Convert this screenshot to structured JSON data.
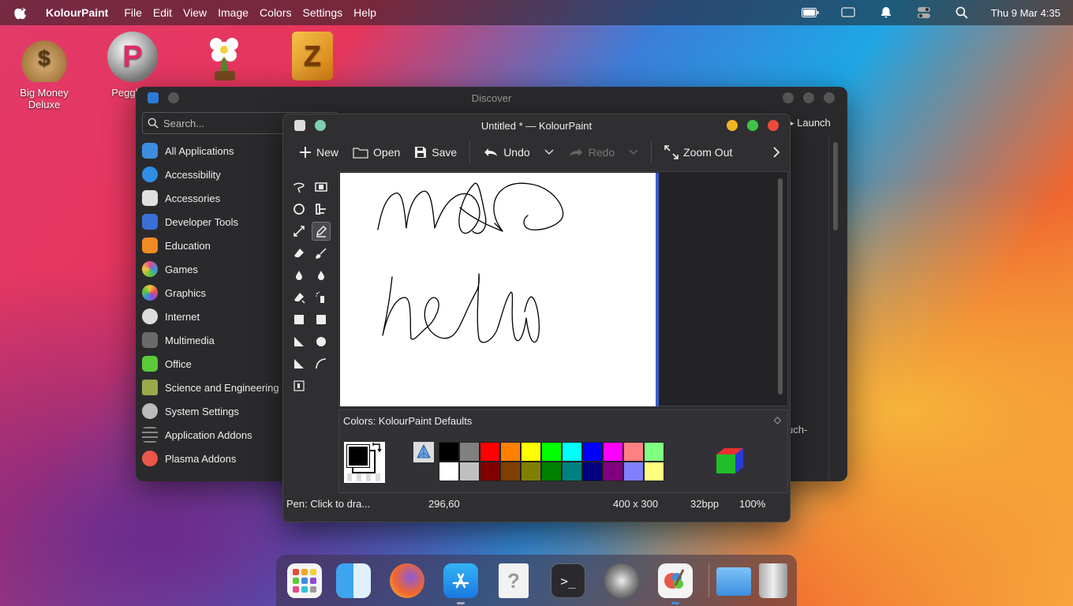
{
  "menubar": {
    "app_name": "KolourPaint",
    "menus": [
      "File",
      "Edit",
      "View",
      "Image",
      "Colors",
      "Settings",
      "Help"
    ],
    "clock": "Thu 9 Mar 4:35"
  },
  "desktop_icons": [
    {
      "label": "Big Money\nDeluxe",
      "line1": "Big Money",
      "line2": "Deluxe"
    },
    {
      "label": "Peggle D",
      "line1": "Peggle D"
    },
    {
      "label": ""
    },
    {
      "label": ""
    }
  ],
  "discover": {
    "title": "Discover",
    "search_placeholder": "Search...",
    "launch_label": "Launch",
    "truncated_text": "uch-",
    "categories": [
      {
        "label": "All Applications",
        "icon": "grid-icon",
        "color": "#3d8ee0"
      },
      {
        "label": "Accessibility",
        "icon": "accessibility-icon",
        "color": "#2f8de4"
      },
      {
        "label": "Accessories",
        "icon": "accessories-icon",
        "color": "#e0e0e0"
      },
      {
        "label": "Developer Tools",
        "icon": "developer-tools-icon",
        "color": "#3a6fd8"
      },
      {
        "label": "Education",
        "icon": "education-icon",
        "color": "#f08a24"
      },
      {
        "label": "Games",
        "icon": "games-icon",
        "color": "#e04b8c"
      },
      {
        "label": "Graphics",
        "icon": "graphics-icon",
        "color": "#f4c33c"
      },
      {
        "label": "Internet",
        "icon": "internet-icon",
        "color": "#dddddd"
      },
      {
        "label": "Multimedia",
        "icon": "multimedia-icon",
        "color": "#aaaaaa"
      },
      {
        "label": "Office",
        "icon": "office-icon",
        "color": "#5cc93a"
      },
      {
        "label": "Science and Engineering",
        "icon": "science-icon",
        "color": "#9aa94a"
      },
      {
        "label": "System Settings",
        "icon": "system-settings-icon",
        "color": "#bbbbbb"
      },
      {
        "label": "Application Addons",
        "icon": "addons-icon",
        "color": "#888888"
      },
      {
        "label": "Plasma Addons",
        "icon": "plasma-addons-icon",
        "color": "#e8574a"
      }
    ]
  },
  "kolourpaint": {
    "title": "Untitled * — KolourPaint",
    "toolbar": {
      "new": "New",
      "open": "Open",
      "save": "Save",
      "undo": "Undo",
      "redo": "Redo",
      "zoom_out": "Zoom Out"
    },
    "colors_header": "Colors: KolourPaint Defaults",
    "palette_top": [
      "#000000",
      "#808080",
      "#ff0000",
      "#ff8000",
      "#ffff00",
      "#00ff00",
      "#00ffff",
      "#0000ff",
      "#ff00ff",
      "#ff8080",
      "#80ff80"
    ],
    "palette_bottom": [
      "#ffffff",
      "#c0c0c0",
      "#800000",
      "#804000",
      "#808000",
      "#008000",
      "#008080",
      "#000080",
      "#800080",
      "#8080ff",
      "#ffff80"
    ],
    "status": {
      "message": "Pen: Click to dra...",
      "coords": "296,60",
      "size": "400 x 300",
      "depth": "32bpp",
      "zoom": "100%"
    }
  },
  "dock": {
    "items": [
      "launchpad-icon",
      "finder-icon",
      "firefox-icon",
      "app-store-icon",
      "help-icon",
      "terminal-icon",
      "system-preferences-icon",
      "kolourpaint-icon",
      "folder-icon",
      "trash-icon"
    ]
  }
}
